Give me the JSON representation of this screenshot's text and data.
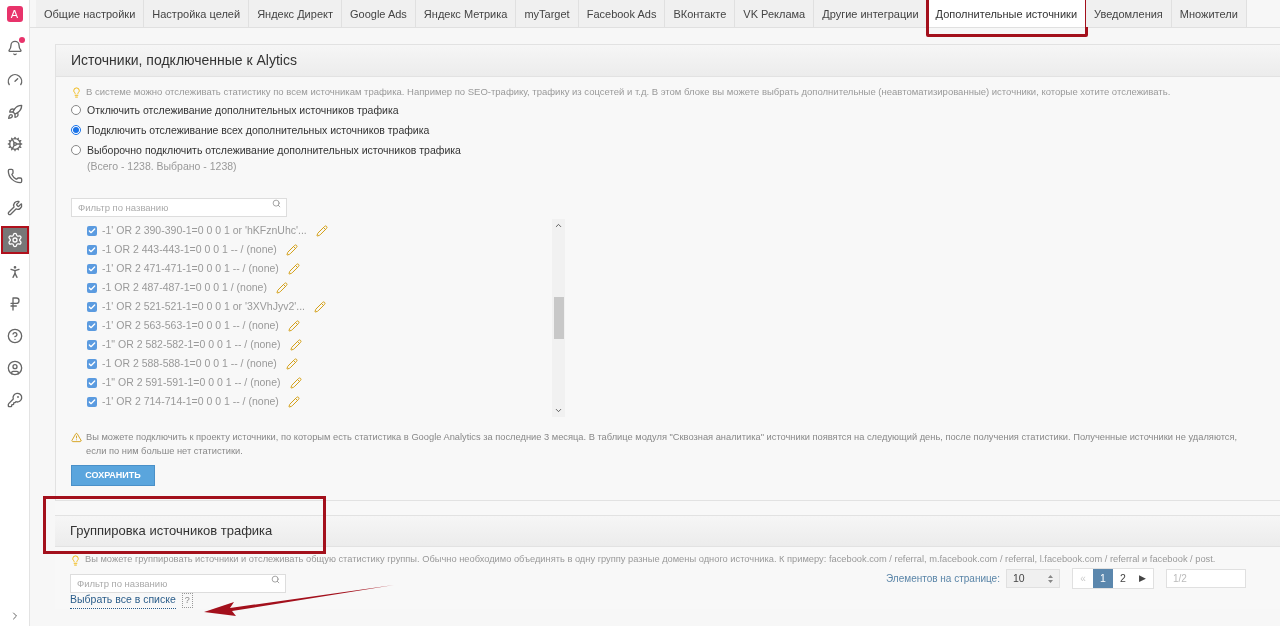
{
  "sidebar": {
    "logo": "A",
    "items": [
      {
        "kind": "bell",
        "selected": false,
        "dot": true
      },
      {
        "kind": "gauge",
        "selected": false,
        "dot": false
      },
      {
        "kind": "rocket",
        "selected": false,
        "dot": false
      },
      {
        "kind": "cogs",
        "selected": false,
        "dot": false
      },
      {
        "kind": "phone",
        "selected": false,
        "dot": false
      },
      {
        "kind": "tools",
        "selected": false,
        "dot": false
      },
      {
        "kind": "settings",
        "selected": true,
        "dot": false
      },
      {
        "kind": "person",
        "selected": false,
        "dot": false
      },
      {
        "kind": "ruble",
        "selected": false,
        "dot": false
      },
      {
        "kind": "help",
        "selected": false,
        "dot": false
      },
      {
        "kind": "user",
        "selected": false,
        "dot": false
      },
      {
        "kind": "key",
        "selected": false,
        "dot": false
      }
    ]
  },
  "tabs": [
    {
      "label": "Общие настройки",
      "selected": false
    },
    {
      "label": "Настройка целей",
      "selected": false
    },
    {
      "label": "Яндекс Директ",
      "selected": false
    },
    {
      "label": "Google Ads",
      "selected": false
    },
    {
      "label": "Яндекс Метрика",
      "selected": false
    },
    {
      "label": "myTarget",
      "selected": false
    },
    {
      "label": "Facebook Ads",
      "selected": false
    },
    {
      "label": "ВКонтакте",
      "selected": false
    },
    {
      "label": "VK Реклама",
      "selected": false
    },
    {
      "label": "Другие интеграции",
      "selected": false
    },
    {
      "label": "Дополнительные источники",
      "selected": true
    },
    {
      "label": "Уведомления",
      "selected": false
    },
    {
      "label": "Множители",
      "selected": false
    }
  ],
  "sources_panel": {
    "title": "Источники, подключенные к Alytics",
    "info": "В системе можно отслеживать статистику по всем источникам трафика. Например по SEO-трафику, трафику из соцсетей и т.д. В этом блоке вы можете выбрать дополнительные (неавтоматизированные) источники, которые хотите отслеживать.",
    "options": [
      {
        "label": "Отключить отслеживание дополнительных источников трафика",
        "selected": false
      },
      {
        "label": "Подключить отслеживание всех дополнительных источников трафика",
        "selected": true
      },
      {
        "label": "Выборочно подключить отслеживание дополнительных источников трафика",
        "note": "(Всего - 1238. Выбрано - 1238)",
        "selected": false
      }
    ],
    "filter": {
      "placeholder": "Фильтр по названию"
    },
    "sources": [
      {
        "label": "-1' OR 2 390-390-1=0 0 0 1 or 'hKFznUhc'...",
        "checked": true
      },
      {
        "label": "-1 OR 2 443-443-1=0 0 0 1 -- / (none)",
        "checked": true
      },
      {
        "label": "-1' OR 2 471-471-1=0 0 0 1 -- / (none)",
        "checked": true
      },
      {
        "label": "-1 OR 2 487-487-1=0 0 0 1 / (none)",
        "checked": true
      },
      {
        "label": "-1' OR 2 521-521-1=0 0 0 1 or '3XVhJyv2'...",
        "checked": true
      },
      {
        "label": "-1' OR 2 563-563-1=0 0 0 1 -- / (none)",
        "checked": true
      },
      {
        "label": "-1\" OR 2 582-582-1=0 0 0 1 -- / (none)",
        "checked": true
      },
      {
        "label": "-1 OR 2 588-588-1=0 0 0 1 -- / (none)",
        "checked": true
      },
      {
        "label": "-1\" OR 2 591-591-1=0 0 0 1 -- / (none)",
        "checked": true
      },
      {
        "label": "-1' OR 2 714-714-1=0 0 0 1 -- / (none)",
        "checked": true
      }
    ],
    "warning_lines": [
      "Вы можете подключить к проекту источники, по которым есть статистика в Google Analytics за последние 3 месяца. В таблице модуля \"Сквозная аналитика\" источники появятся на следующий день, после получения статистики. Полученные источники не удаляются,",
      "если по ним больше нет статистики."
    ],
    "save_button": "СОХРАНИТЬ"
  },
  "grouping_panel": {
    "title": "Группировка источников трафика",
    "info": "Вы можете группировать источники и отслеживать общую статистику группы. Обычно необходимо объединять в одну группу разные домены одного источника. К примеру: facebook.com / referral, m.facebook.com / referral, l.facebook.com / referral и facebook / post.",
    "filter": {
      "placeholder": "Фильтр по названию"
    },
    "select_all": "Выбрать все в списке",
    "help": "?",
    "pagination": {
      "label": "Элементов на странице:",
      "per_page": "10",
      "prev": "«",
      "pages": [
        {
          "label": "1",
          "selected": true
        },
        {
          "label": "2",
          "selected": false
        }
      ],
      "next": "▶",
      "page_input": {
        "placeholder": "1/2"
      }
    }
  }
}
